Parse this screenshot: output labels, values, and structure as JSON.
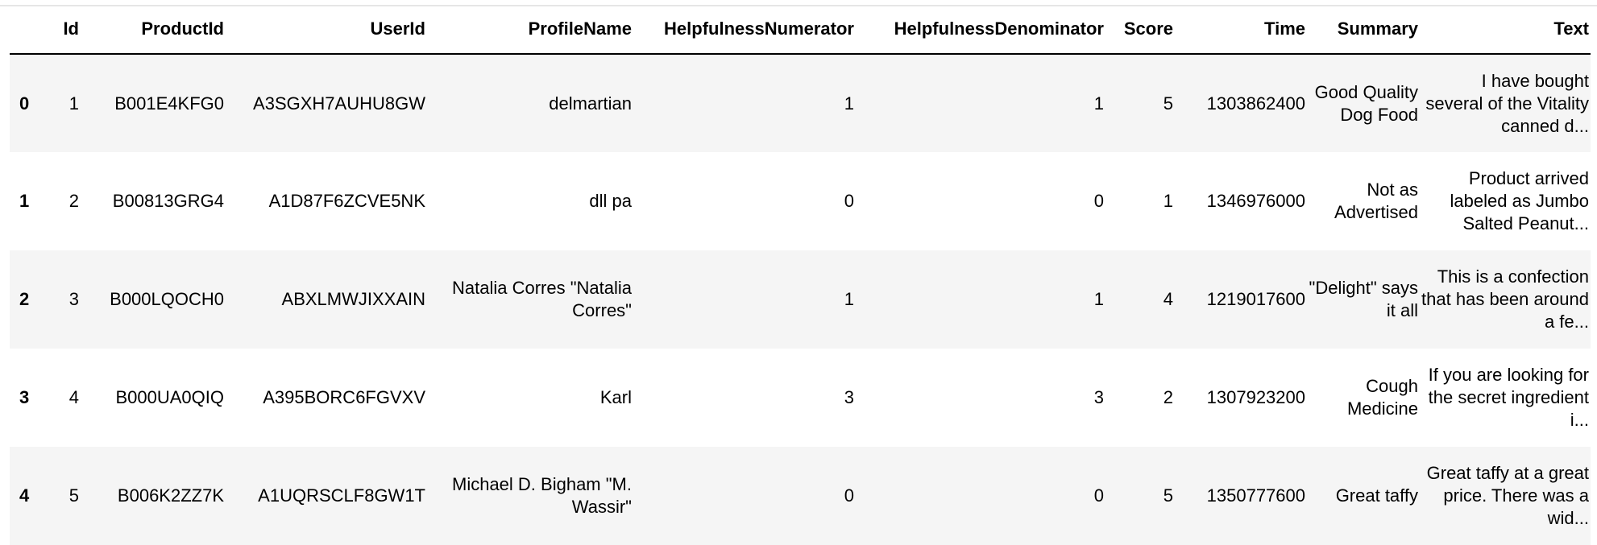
{
  "columns": [
    "",
    "Id",
    "ProductId",
    "UserId",
    "ProfileName",
    "HelpfulnessNumerator",
    "HelpfulnessDenominator",
    "Score",
    "Time",
    "Summary",
    "Text"
  ],
  "rows": [
    {
      "index": "0",
      "Id": "1",
      "ProductId": "B001E4KFG0",
      "UserId": "A3SGXH7AUHU8GW",
      "ProfileName": "delmartian",
      "HelpfulnessNumerator": "1",
      "HelpfulnessDenominator": "1",
      "Score": "5",
      "Time": "1303862400",
      "Summary": "Good Quality Dog Food",
      "Text": "I have bought several of the Vitality canned d..."
    },
    {
      "index": "1",
      "Id": "2",
      "ProductId": "B00813GRG4",
      "UserId": "A1D87F6ZCVE5NK",
      "ProfileName": "dll pa",
      "HelpfulnessNumerator": "0",
      "HelpfulnessDenominator": "0",
      "Score": "1",
      "Time": "1346976000",
      "Summary": "Not as Advertised",
      "Text": "Product arrived labeled as Jumbo Salted Peanut..."
    },
    {
      "index": "2",
      "Id": "3",
      "ProductId": "B000LQOCH0",
      "UserId": "ABXLMWJIXXAIN",
      "ProfileName": "Natalia Corres \"Natalia Corres\"",
      "HelpfulnessNumerator": "1",
      "HelpfulnessDenominator": "1",
      "Score": "4",
      "Time": "1219017600",
      "Summary": "\"Delight\" says it all",
      "Text": "This is a confection that has been around a fe..."
    },
    {
      "index": "3",
      "Id": "4",
      "ProductId": "B000UA0QIQ",
      "UserId": "A395BORC6FGVXV",
      "ProfileName": "Karl",
      "HelpfulnessNumerator": "3",
      "HelpfulnessDenominator": "3",
      "Score": "2",
      "Time": "1307923200",
      "Summary": "Cough Medicine",
      "Text": "If you are looking for the secret ingredient i..."
    },
    {
      "index": "4",
      "Id": "5",
      "ProductId": "B006K2ZZ7K",
      "UserId": "A1UQRSCLF8GW1T",
      "ProfileName": "Michael D. Bigham \"M. Wassir\"",
      "HelpfulnessNumerator": "0",
      "HelpfulnessDenominator": "0",
      "Score": "5",
      "Time": "1350777600",
      "Summary": "Great taffy",
      "Text": "Great taffy at a great price. There was a wid..."
    }
  ]
}
